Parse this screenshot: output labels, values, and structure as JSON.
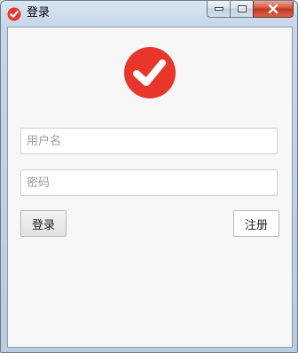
{
  "window": {
    "title": "登录",
    "icon": "check-logo-icon",
    "controls": [
      "minimize-icon",
      "maximize-icon",
      "close-icon"
    ]
  },
  "colors": {
    "accent": "#e8362b",
    "client_bg": "#f7f7f7"
  },
  "form": {
    "username": {
      "value": "",
      "placeholder": "用户名"
    },
    "password": {
      "value": "",
      "placeholder": "密码"
    },
    "login_label": "登录",
    "register_label": "注册"
  }
}
